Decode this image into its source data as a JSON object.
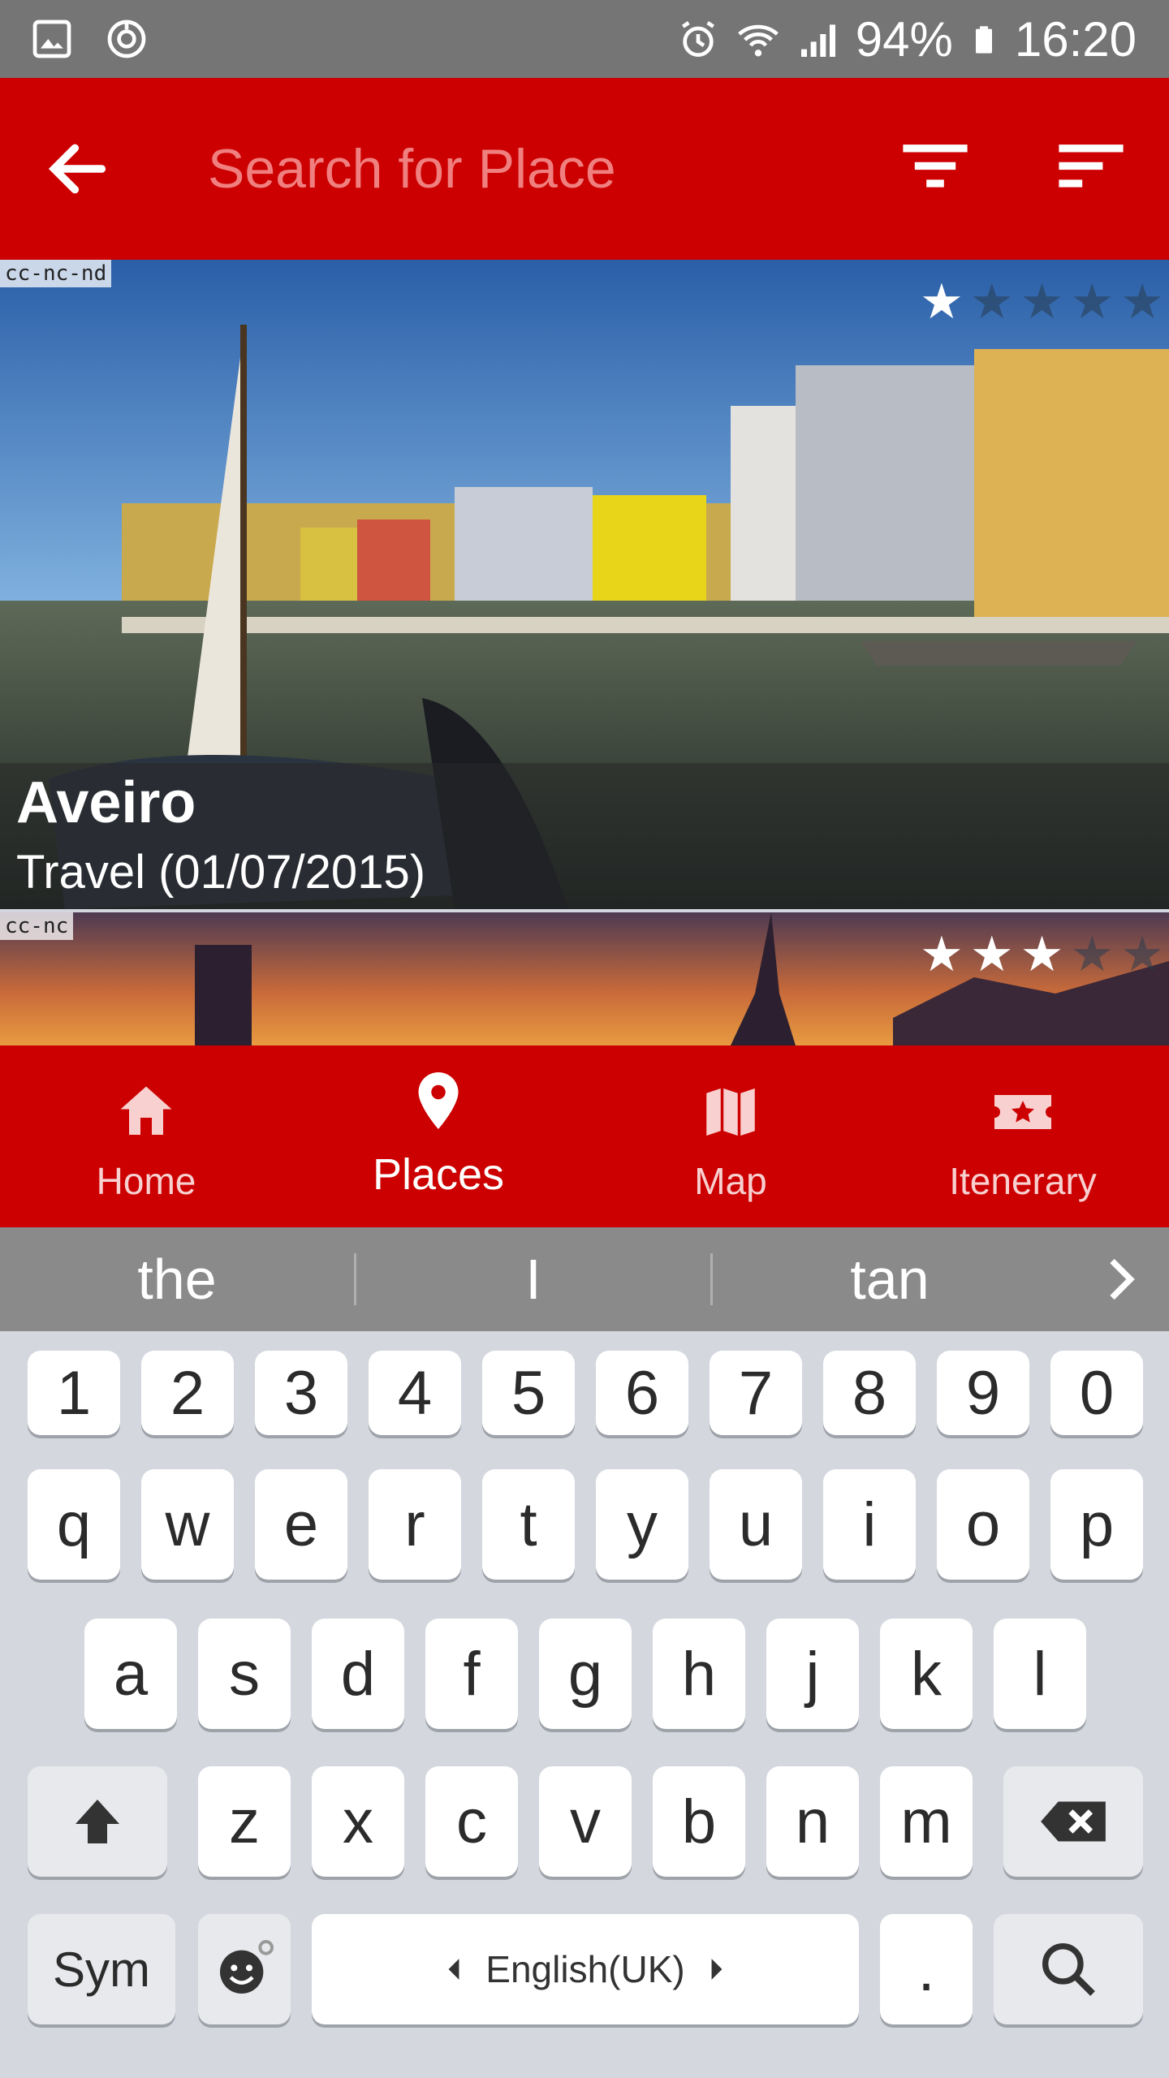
{
  "status_bar": {
    "battery": "94%",
    "time": "16:20",
    "icons_left": [
      "gallery-icon",
      "sync-icon"
    ],
    "icons_right": [
      "alarm-icon",
      "wifi-icon",
      "signal-icon",
      "battery-icon"
    ]
  },
  "app_bar": {
    "search_placeholder": "Search for Place",
    "back_icon": "arrow-left-icon",
    "filter_icon": "filter-icon",
    "sort_icon": "sort-icon"
  },
  "cards": [
    {
      "license": "cc-nc-nd",
      "title": "Aveiro",
      "subtitle": "Travel (01/07/2015)",
      "rating": 1,
      "max_rating": 5
    },
    {
      "license": "cc-nc",
      "rating": 3,
      "max_rating": 5
    }
  ],
  "bottom_nav": {
    "items": [
      {
        "label": "Home",
        "icon": "home-icon"
      },
      {
        "label": "Places",
        "icon": "place-pin-icon"
      },
      {
        "label": "Map",
        "icon": "map-icon"
      },
      {
        "label": "Itenerary",
        "icon": "ticket-star-icon"
      }
    ],
    "active": "Places"
  },
  "keyboard": {
    "suggestions": [
      "the",
      "I",
      "tan"
    ],
    "rows": {
      "numbers": [
        "1",
        "2",
        "3",
        "4",
        "5",
        "6",
        "7",
        "8",
        "9",
        "0"
      ],
      "row1": [
        "q",
        "w",
        "e",
        "r",
        "t",
        "y",
        "u",
        "i",
        "o",
        "p"
      ],
      "row2": [
        "a",
        "s",
        "d",
        "f",
        "g",
        "h",
        "j",
        "k",
        "l"
      ],
      "row3": [
        "z",
        "x",
        "c",
        "v",
        "b",
        "n",
        "m"
      ]
    },
    "sym_label": "Sym",
    "language_label": "English(UK)",
    "period_label": "."
  },
  "colors": {
    "primary": "#cc0000",
    "status_bar": "#757575",
    "keyboard_bg": "#d4d7de"
  }
}
